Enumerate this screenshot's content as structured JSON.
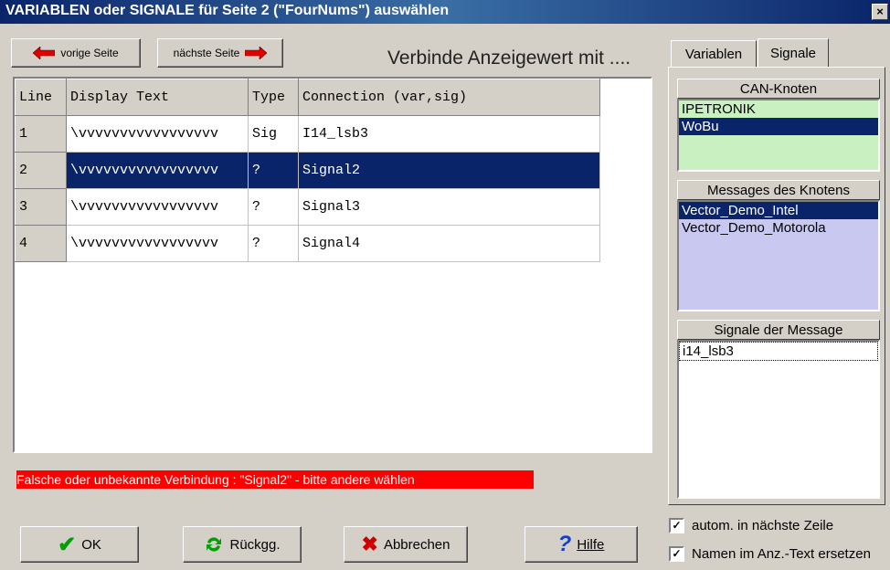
{
  "window": {
    "title": "VARIABLEN oder SIGNALE für Seite 2 (\"FourNums\") auswählen",
    "close": "×"
  },
  "nav": {
    "prev": "vorige Seite",
    "next": "nächste Seite"
  },
  "heading": "Verbinde Anzeigewert mit ....",
  "grid": {
    "headers": [
      "Line",
      "Display Text",
      "Type",
      "Connection (var,sig)"
    ],
    "rows": [
      {
        "line": "1",
        "text": "\\vvvvvvvvvvvvvvvvv",
        "type": "Sig",
        "conn": "I14_lsb3"
      },
      {
        "line": "2",
        "text": "\\vvvvvvvvvvvvvvvvv",
        "type": "?",
        "conn": "Signal2"
      },
      {
        "line": "3",
        "text": "\\vvvvvvvvvvvvvvvvv",
        "type": "?",
        "conn": "Signal3"
      },
      {
        "line": "4",
        "text": "\\vvvvvvvvvvvvvvvvv",
        "type": "?",
        "conn": "Signal4"
      }
    ],
    "selected_row": 2
  },
  "error": "Falsche oder unbekannte Verbindung : \"Signal2\"  -  bitte andere wählen",
  "tabs": [
    "Variablen",
    "Signale"
  ],
  "active_tab": "Signale",
  "can_nodes": {
    "header": "CAN-Knoten",
    "items": [
      "IPETRONIK",
      "WoBu"
    ],
    "selected": "WoBu",
    "color": "#c8f0c0"
  },
  "messages": {
    "header": "Messages des Knotens",
    "items": [
      "Vector_Demo_Intel",
      "Vector_Demo_Motorola"
    ],
    "selected": "Vector_Demo_Intel",
    "color": "#c8c8f0"
  },
  "signals": {
    "header": "Signale der Message",
    "items": [
      "i14_lsb3"
    ]
  },
  "buttons": {
    "ok": "OK",
    "undo": "Rückgg.",
    "cancel": "Abbrechen",
    "help": "Hilfe"
  },
  "checkboxes": [
    {
      "label": "autom. in nächste Zeile",
      "checked": true
    },
    {
      "label": "Namen im Anz.-Text ersetzen",
      "checked": true
    }
  ]
}
